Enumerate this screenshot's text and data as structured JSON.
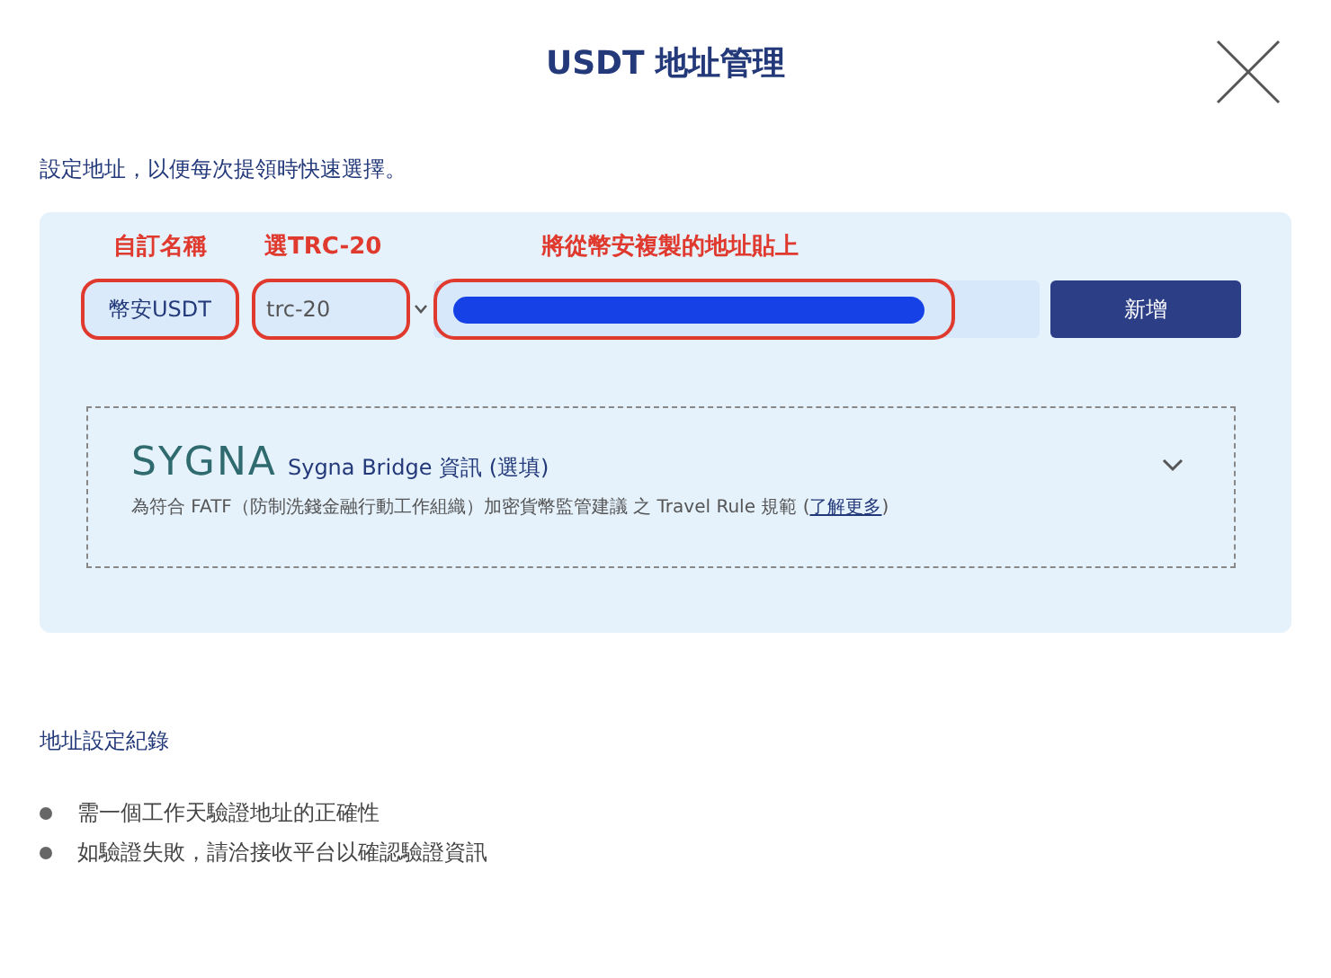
{
  "dialog": {
    "title": "USDT 地址管理",
    "intro": "設定地址，以便每次提領時快速選擇。"
  },
  "annotations": [
    "自訂名稱",
    "選TRC-20",
    "將從幣安複製的地址貼上"
  ],
  "form": {
    "name_value": "幣安USDT",
    "network_value": "trc-20",
    "add_button": "新增"
  },
  "sygna": {
    "logo": "SYGNA",
    "title": "Sygna Bridge 資訊 (選填)",
    "description_before": "為符合 FATF（防制洗錢金融行動工作組織）加密貨幣監管建議 之 Travel Rule 規範 (",
    "link": "了解更多",
    "description_after": ")",
    "expanded": false
  },
  "records": {
    "heading": "地址設定紀錄",
    "notes": [
      "需一個工作天驗證地址的正確性",
      "如驗證失敗，請洽接收平台以確認驗證資訊"
    ]
  }
}
